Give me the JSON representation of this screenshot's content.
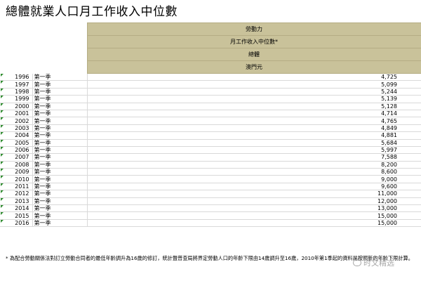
{
  "title": "總體就業人口月工作收入中位數",
  "headers": [
    "勞動力",
    "月工作收入中位數*",
    "總體",
    "澳門元"
  ],
  "rows": [
    {
      "year": "1996",
      "quarter": "第一季",
      "value": "4,725"
    },
    {
      "year": "1997",
      "quarter": "第一季",
      "value": "5,099"
    },
    {
      "year": "1998",
      "quarter": "第一季",
      "value": "5,244"
    },
    {
      "year": "1999",
      "quarter": "第一季",
      "value": "5,139"
    },
    {
      "year": "2000",
      "quarter": "第一季",
      "value": "5,128"
    },
    {
      "year": "2001",
      "quarter": "第一季",
      "value": "4,714"
    },
    {
      "year": "2002",
      "quarter": "第一季",
      "value": "4,765"
    },
    {
      "year": "2003",
      "quarter": "第一季",
      "value": "4,849"
    },
    {
      "year": "2004",
      "quarter": "第一季",
      "value": "4,881"
    },
    {
      "year": "2005",
      "quarter": "第一季",
      "value": "5,684"
    },
    {
      "year": "2006",
      "quarter": "第一季",
      "value": "5,997"
    },
    {
      "year": "2007",
      "quarter": "第一季",
      "value": "7,588"
    },
    {
      "year": "2008",
      "quarter": "第一季",
      "value": "8,200"
    },
    {
      "year": "2009",
      "quarter": "第一季",
      "value": "8,600"
    },
    {
      "year": "2010",
      "quarter": "第一季",
      "value": "9,000"
    },
    {
      "year": "2011",
      "quarter": "第一季",
      "value": "9,600"
    },
    {
      "year": "2012",
      "quarter": "第一季",
      "value": "11,000"
    },
    {
      "year": "2013",
      "quarter": "第一季",
      "value": "12,000"
    },
    {
      "year": "2014",
      "quarter": "第一季",
      "value": "13,000"
    },
    {
      "year": "2015",
      "quarter": "第一季",
      "value": "15,000"
    },
    {
      "year": "2016",
      "quarter": "第一季",
      "value": "15,000"
    }
  ],
  "footnote": "* 為配合勞動關係法對訂立勞動合同者的最低年齡調升為16歲的修訂，統計暨普查局將界定勞動人口的年齡下限由14歲調升至16歲，2010年第1季起的資料是按照新的年齡下限計算。",
  "watermark": "时文精选",
  "colors": {
    "header_bg": "#c9c29a",
    "marker": "#2e8b2e"
  }
}
